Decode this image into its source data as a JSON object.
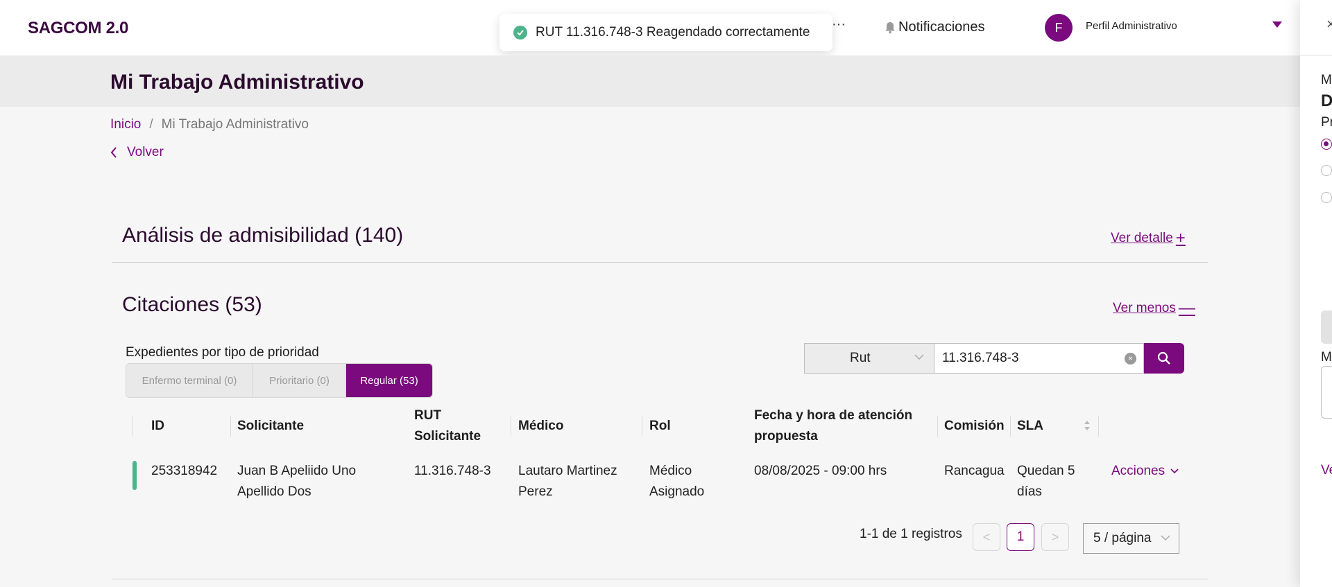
{
  "app": {
    "brand": "SAGCOM 2.0"
  },
  "header": {
    "more": "···",
    "notifications_label": "Notificaciones",
    "avatar_initial": "F",
    "profile_name": "Perfil Administrativo"
  },
  "toast": {
    "message": "RUT 11.316.748-3 Reagendado correctamente",
    "status_color": "#4db38a"
  },
  "page": {
    "title": "Mi Trabajo Administrativo",
    "breadcrumb": {
      "home": "Inicio",
      "separator": "/",
      "current": "Mi Trabajo Administrativo"
    },
    "back_label": "Volver"
  },
  "sections": {
    "admisibilidad": {
      "title": "Análisis de admisibilidad (140)",
      "link": "Ver detalle",
      "link_symbol": "+"
    },
    "citaciones": {
      "title": "Citaciones (53)",
      "link": "Ver menos",
      "link_symbol": "—"
    }
  },
  "priority": {
    "label": "Expedientes por tipo de prioridad",
    "segments": [
      "Enfermo terminal (0)",
      "Prioritario (0)",
      "Regular (53)"
    ],
    "active": "Regular (53)"
  },
  "filter": {
    "field": "Rut",
    "value": "11.316.748-3"
  },
  "table": {
    "headers": {
      "id": "ID",
      "solicitante": "Solicitante",
      "rut_l1": "RUT",
      "rut_l2": "Solicitante",
      "medico": "Médico",
      "rol": "Rol",
      "fecha_l1": "Fecha y hora de atención",
      "fecha_l2": "propuesta",
      "comision": "Comisión",
      "sla": "SLA"
    },
    "rows": [
      {
        "id": "253318942",
        "solicitante_l1": "Juan B Apeliido Uno",
        "solicitante_l2": "Apellido Dos",
        "rut": "11.316.748-3",
        "medico_l1": "Lautaro Martinez",
        "medico_l2": "Perez",
        "rol_l1": "Médico",
        "rol_l2": "Asignado",
        "fecha": "08/08/2025 - 09:00 hrs",
        "comision": "Rancagua",
        "sla_l1": "Quedan 5",
        "sla_l2": "días",
        "actions": "Acciones"
      }
    ]
  },
  "pagination": {
    "info": "1-1 de 1 registros",
    "prev": "<",
    "current_page": "1",
    "next": ">",
    "page_size": "5 / página"
  },
  "side_panel": {
    "close": "×",
    "text_1": "M",
    "text_2": "D",
    "text_3": "Pr",
    "text_4": "M",
    "link": "Ve"
  },
  "colors": {
    "brand": "#7a0a7e",
    "title": "#2b0a2e",
    "success": "#4db38a"
  }
}
